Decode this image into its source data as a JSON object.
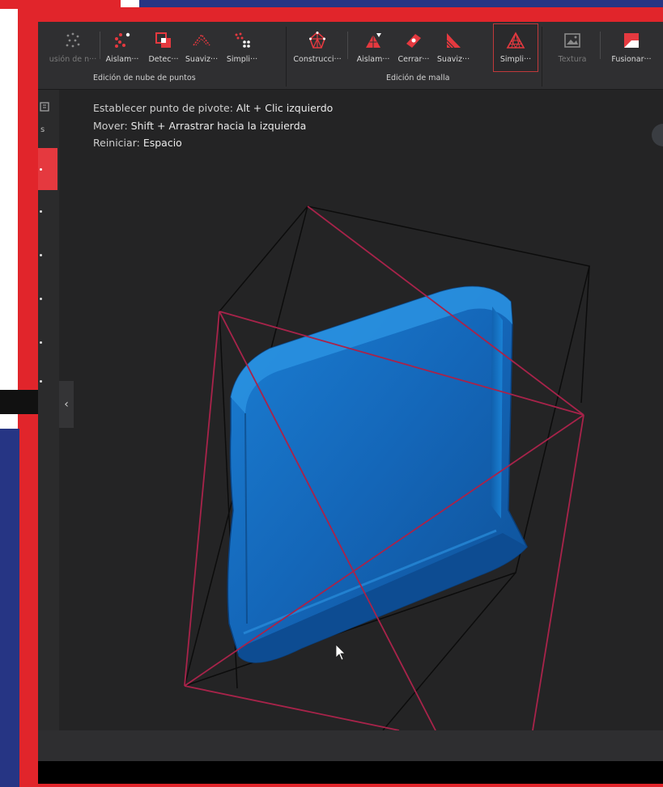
{
  "toolbar": {
    "point_cloud_tools": [
      {
        "label": "usión de n···",
        "icon": "points-fusion-icon",
        "dim": true
      },
      {
        "label": "Aislam···",
        "icon": "isolate-points-icon"
      },
      {
        "label": "Detec···",
        "icon": "detect-icon"
      },
      {
        "label": "Suaviz···",
        "icon": "smooth-points-icon"
      },
      {
        "label": "Simpli···",
        "icon": "simplify-points-icon"
      }
    ],
    "point_cloud_group": "Edición de nube de puntos",
    "mesh_tools": [
      {
        "label": "Construcci···",
        "icon": "construct-mesh-icon"
      },
      {
        "label": "Aislam···",
        "icon": "isolate-mesh-icon"
      },
      {
        "label": "Cerrar···",
        "icon": "close-holes-icon"
      },
      {
        "label": "Suaviz···",
        "icon": "smooth-mesh-icon"
      },
      {
        "label": "Simpli···",
        "icon": "simplify-mesh-icon",
        "active": true
      }
    ],
    "mesh_group": "Edición de malla",
    "extra_tools": [
      {
        "label": "Textura",
        "icon": "texture-icon",
        "dim": true
      },
      {
        "label": "Fusionar···",
        "icon": "merge-icon"
      }
    ]
  },
  "hints": [
    {
      "key": "Establecer punto de pivote:",
      "value": "Alt + Clic izquierdo"
    },
    {
      "key": "Mover:",
      "value": "Shift + Arrastrar hacia la izquierda"
    },
    {
      "key": "Reiniciar:",
      "value": "Espacio"
    }
  ],
  "sidebar": {
    "collapse_glyph": "‹",
    "partial_label": "s"
  },
  "colors": {
    "accent": "#e1252b",
    "frame_navy": "#263584",
    "mesh_blue": "#1570c8",
    "box_red": "#b0234a"
  }
}
